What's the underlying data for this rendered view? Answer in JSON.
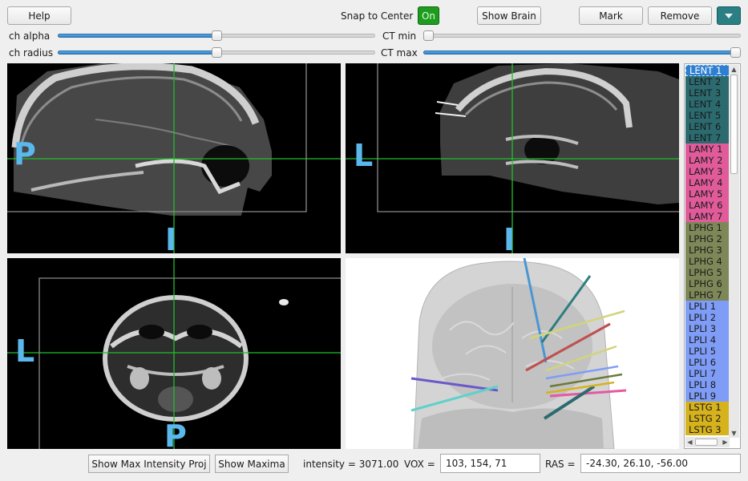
{
  "toolbar": {
    "help_label": "Help",
    "snap_label": "Snap to Center",
    "snap_state": "On",
    "show_brain_label": "Show Brain",
    "mark_label": "Mark",
    "remove_label": "Remove"
  },
  "sliders": {
    "ch_alpha": {
      "label": "ch alpha",
      "value": 0.5
    },
    "ch_radius": {
      "label": "ch radius",
      "value": 0.5
    },
    "ct_min": {
      "label": "CT min",
      "value": 0.0
    },
    "ct_max": {
      "label": "CT max",
      "value": 1.0
    }
  },
  "views": {
    "sagittal": {
      "left_label": "P",
      "bottom_label": "I"
    },
    "coronal": {
      "left_label": "L",
      "bottom_label": "I"
    },
    "axial": {
      "left_label": "L",
      "bottom_label": "P"
    }
  },
  "channel_list": [
    {
      "label": "LENT 1",
      "color": "#2e7fd0",
      "selected": true
    },
    {
      "label": "LENT 2",
      "color": "#2b6b70"
    },
    {
      "label": "LENT 3",
      "color": "#2b6b70"
    },
    {
      "label": "LENT 4",
      "color": "#2b6b70"
    },
    {
      "label": "LENT 5",
      "color": "#2b6b70"
    },
    {
      "label": "LENT 6",
      "color": "#2b6b70"
    },
    {
      "label": "LENT 7",
      "color": "#2b6b70"
    },
    {
      "label": "LAMY 1",
      "color": "#e15b9b"
    },
    {
      "label": "LAMY 2",
      "color": "#e15b9b"
    },
    {
      "label": "LAMY 3",
      "color": "#e15b9b"
    },
    {
      "label": "LAMY 4",
      "color": "#e15b9b"
    },
    {
      "label": "LAMY 5",
      "color": "#e15b9b"
    },
    {
      "label": "LAMY 6",
      "color": "#e15b9b"
    },
    {
      "label": "LAMY 7",
      "color": "#e15b9b"
    },
    {
      "label": "LPHG 1",
      "color": "#7d8757"
    },
    {
      "label": "LPHG 2",
      "color": "#7d8757"
    },
    {
      "label": "LPHG 3",
      "color": "#7d8757"
    },
    {
      "label": "LPHG 4",
      "color": "#7d8757"
    },
    {
      "label": "LPHG 5",
      "color": "#7d8757"
    },
    {
      "label": "LPHG 6",
      "color": "#7d8757"
    },
    {
      "label": "LPHG 7",
      "color": "#7d8757"
    },
    {
      "label": "LPLI 1",
      "color": "#7f9df7"
    },
    {
      "label": "LPLI 2",
      "color": "#7f9df7"
    },
    {
      "label": "LPLI 3",
      "color": "#7f9df7"
    },
    {
      "label": "LPLI 4",
      "color": "#7f9df7"
    },
    {
      "label": "LPLI 5",
      "color": "#7f9df7"
    },
    {
      "label": "LPLI 6",
      "color": "#7f9df7"
    },
    {
      "label": "LPLI 7",
      "color": "#7f9df7"
    },
    {
      "label": "LPLI 8",
      "color": "#7f9df7"
    },
    {
      "label": "LPLI 9",
      "color": "#7f9df7"
    },
    {
      "label": "LSTG 1",
      "color": "#d6b21d"
    },
    {
      "label": "LSTG 2",
      "color": "#d6b21d"
    },
    {
      "label": "LSTG 3",
      "color": "#d6b21d"
    }
  ],
  "bottom": {
    "max_intensity_label": "Show Max Intensity Proj",
    "show_maxima_label": "Show Maxima",
    "intensity_text": "intensity = 3071.00",
    "vox_label": "VOX =",
    "vox_value": "103, 154,  71",
    "ras_label": "RAS =",
    "ras_value": "-24.30, 26.10, -56.00"
  },
  "colors": {
    "accent": "#2e7fd0",
    "orientation_label": "#5bb8ec",
    "crosshair": "#1fbf2a",
    "toggle_on": "#1f9b1f",
    "dropdown": "#2a7f85"
  }
}
